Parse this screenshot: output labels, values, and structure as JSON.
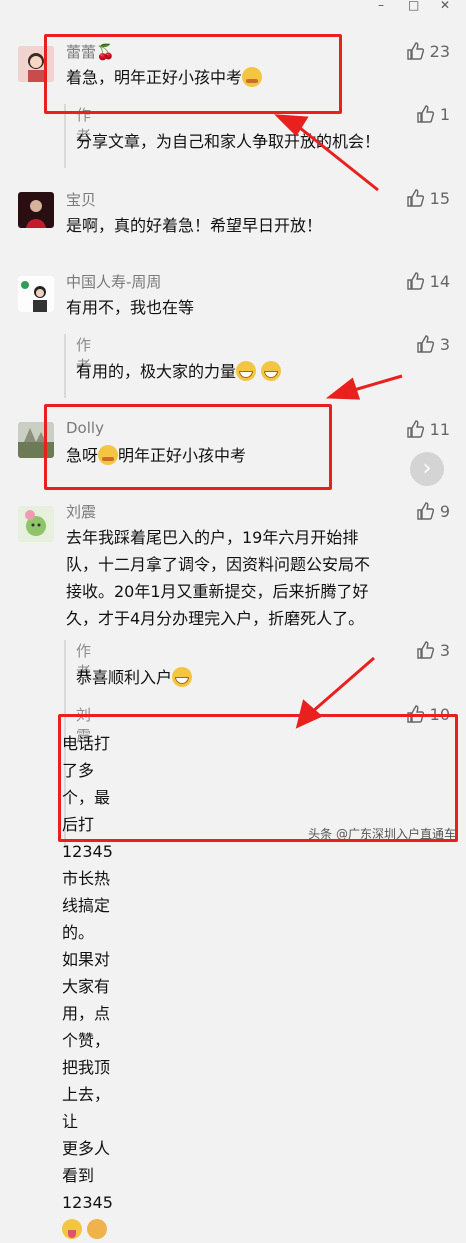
{
  "window": {
    "minimize": "–",
    "maximize": "□",
    "close": "✕"
  },
  "comments": [
    {
      "name": "蕾蕾🍒",
      "text": "着急，明年正好小孩中考",
      "likes": "23",
      "reply": {
        "author": "作者",
        "text": "分享文章，为自己和家人争取开放的机会！",
        "likes": "1"
      }
    },
    {
      "name": "宝贝",
      "text": "是啊，真的好着急！希望早日开放！",
      "likes": "15"
    },
    {
      "name": "中国人寿-周周",
      "text": "有用不，我也在等",
      "likes": "14",
      "reply": {
        "author": "作者",
        "text": "有用的，极大家的力量",
        "likes": "3"
      }
    },
    {
      "name": "Dolly",
      "text_a": "急呀",
      "text_b": "明年正好小孩中考",
      "likes": "11"
    },
    {
      "name": "刘震",
      "lines": [
        "去年我踩着尾巴入的户，19年六月开始排",
        "队，十二月拿了调令，因资料问题公安局不",
        "接收。20年1月又重新提交，后来折腾了好",
        "久，才于4月分办理完入户，折磨死人了。"
      ],
      "likes": "9",
      "reply": {
        "author": "作者",
        "text": "恭喜顺利入户",
        "likes": "3"
      }
    },
    {
      "name": "刘震",
      "likes": "10",
      "lines": [
        "电话打了多个，最后打12345市长热线搞定",
        "的。",
        "如果对大家有用，点个赞，把我顶上去，让",
        "更多人看到12345"
      ]
    }
  ],
  "watermark": "头条 @广东深圳入户直通车",
  "next_arrow": "›",
  "colors": {
    "highlight": "#e8211f",
    "background": "#f2f2f2"
  }
}
